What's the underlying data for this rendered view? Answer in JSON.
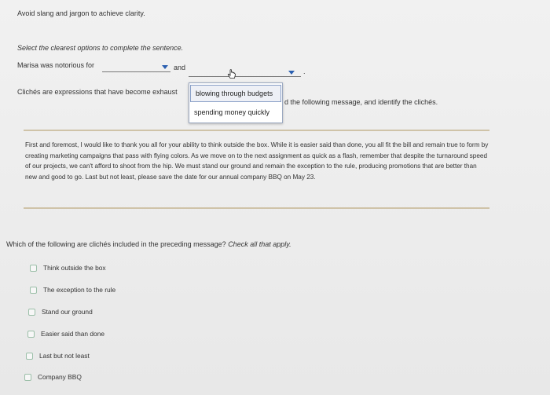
{
  "header": {
    "instruction": "Avoid slang and jargon to achieve clarity."
  },
  "fill_in": {
    "prompt": "Select the clearest options to complete the sentence.",
    "sentence_start": "Marisa was notorious for",
    "conjunction": "and",
    "end_punct": ".",
    "dropdown_1_value": "",
    "dropdown_2_value": "",
    "menu_options": [
      "blowing through budgets",
      "spending money quickly"
    ]
  },
  "cliches": {
    "intro_start": "Clichés are expressions that have become exhaust",
    "intro_end": "d the following message, and identify the clichés."
  },
  "message": {
    "text": "First and foremost, I would like to thank you all for your ability to think outside the box. While it is easier said than done, you all fit the bill and remain true to form by creating marketing campaigns that pass with flying colors. As we move on to the next assignment as quick as a flash, remember that despite the turnaround speed of our projects, we can't afford to shoot from the hip. We must stand our ground and remain the exception to the rule, producing promotions that are better than new and good to go. Last but not least, please save the date for our annual company BBQ on May 23."
  },
  "question": {
    "text_start": "Which of the following are clichés included in the preceding message?",
    "text_emph": "Check all that apply.",
    "options": [
      "Think outside the box",
      "The exception to the rule",
      "Stand our ground",
      "Easier said than done",
      "Last but not least",
      "Company BBQ"
    ]
  },
  "colors": {
    "divider": "#cfc3a8",
    "caret": "#2a5fb0",
    "checkbox_border": "#9bbfa8"
  }
}
